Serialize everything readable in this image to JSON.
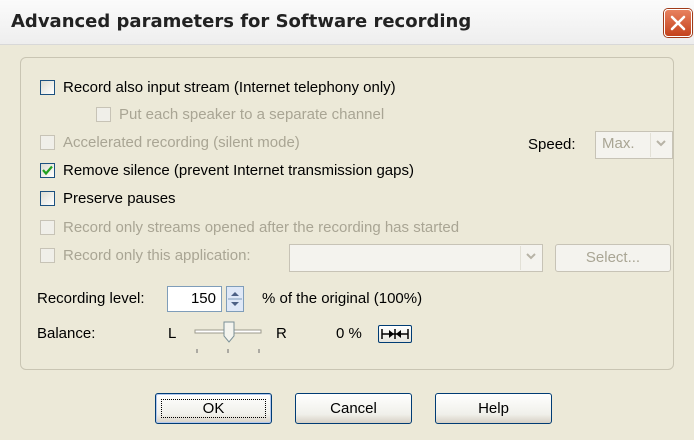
{
  "window": {
    "title": "Advanced parameters for Software recording"
  },
  "options": {
    "record_input_stream": {
      "label": "Record also input stream (Internet telephony only)",
      "checked": false,
      "enabled": true
    },
    "separate_channel": {
      "label": "Put each speaker to a separate channel",
      "checked": false,
      "enabled": false
    },
    "accelerated": {
      "label": "Accelerated recording (silent mode)",
      "checked": false,
      "enabled": false
    },
    "speed_label": "Speed:",
    "speed_value": "Max.",
    "remove_silence": {
      "label": "Remove silence (prevent Internet transmission gaps)",
      "checked": true,
      "enabled": true
    },
    "preserve_pauses": {
      "label": "Preserve pauses",
      "checked": false,
      "enabled": true
    },
    "streams_after_start": {
      "label": "Record only streams opened after the recording has started",
      "checked": false,
      "enabled": false
    },
    "this_application": {
      "label": "Record only this application:",
      "checked": false,
      "enabled": false,
      "value": ""
    },
    "select_label": "Select..."
  },
  "level": {
    "label": "Recording level:",
    "value": "150",
    "suffix": "% of the original (100%)"
  },
  "balance": {
    "label": "Balance:",
    "left": "L",
    "right": "R",
    "value": "0 %",
    "position": 0.5
  },
  "buttons": {
    "ok": "OK",
    "cancel": "Cancel",
    "help": "Help"
  }
}
